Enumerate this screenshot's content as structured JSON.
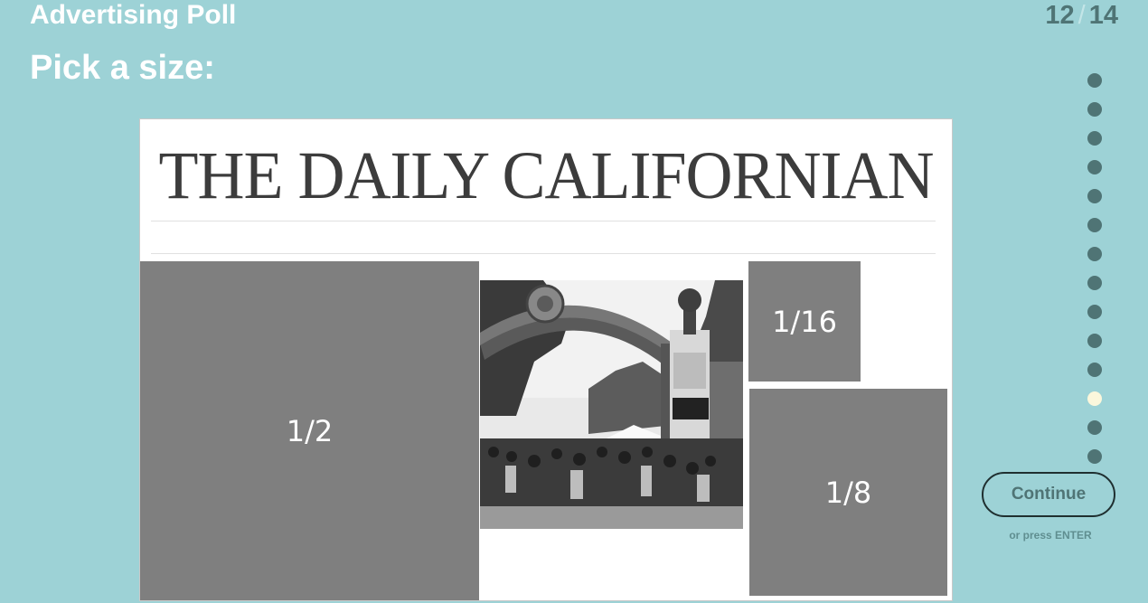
{
  "header": {
    "title": "Advertising Poll",
    "progress_current": "12",
    "progress_separator": "/",
    "progress_total": "14"
  },
  "question": {
    "text": "Pick a size:"
  },
  "newspaper": {
    "masthead": "THE DAILY CALIFORNIAN",
    "photo_icon": "campus-gate-crowd-photo"
  },
  "options": {
    "half": "1/2",
    "sixteenth": "1/16",
    "eighth": "1/8"
  },
  "navigation": {
    "dot_count": 14,
    "active_index": 12,
    "dot_color": "#4f7475",
    "active_dot_color": "#fbf7dc"
  },
  "actions": {
    "continue_label": "Continue",
    "hint": "or press ENTER"
  },
  "colors": {
    "background": "#9dd2d6",
    "ad_block": "#7f7f7f",
    "accent_dark": "#4f7475"
  }
}
